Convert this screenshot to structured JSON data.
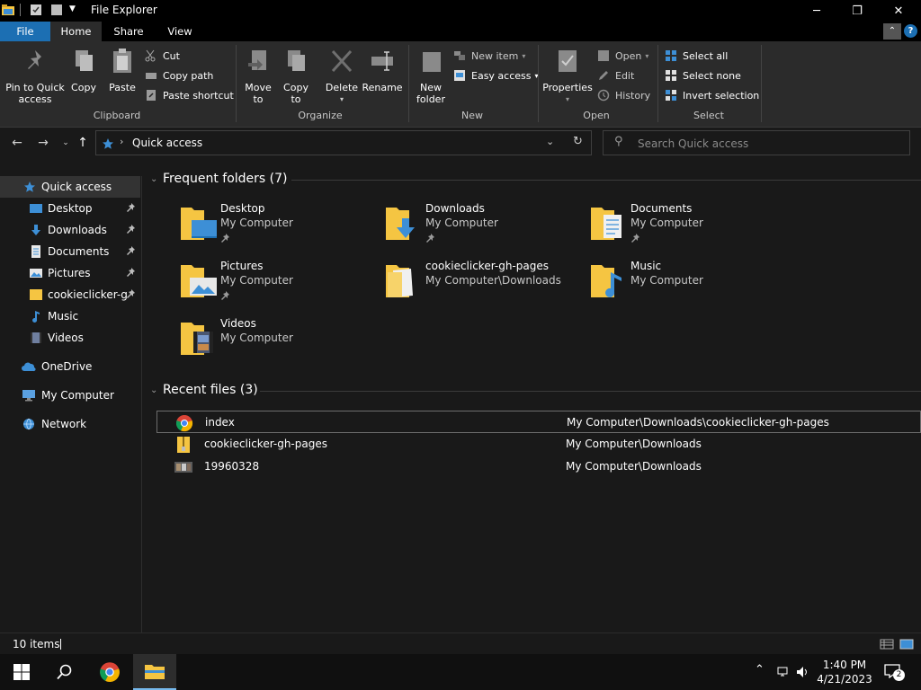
{
  "window": {
    "title": "File Explorer",
    "minimize_glyph": "─",
    "maximize_glyph": "❐",
    "close_glyph": "✕"
  },
  "ribbon_tabs": {
    "file": "File",
    "home": "Home",
    "share": "Share",
    "view": "View",
    "help": "?"
  },
  "ribbon": {
    "clipboard": {
      "pin_line1": "Pin to Quick",
      "pin_line2": "access",
      "copy": "Copy",
      "paste": "Paste",
      "cut": "Cut",
      "copy_path": "Copy path",
      "paste_shortcut": "Paste shortcut",
      "label": "Clipboard"
    },
    "organize": {
      "move_line1": "Move",
      "move_line2": "to",
      "copy_line1": "Copy",
      "copy_line2": "to",
      "delete": "Delete",
      "rename": "Rename",
      "label": "Organize"
    },
    "new": {
      "new_folder_line1": "New",
      "new_folder_line2": "folder",
      "new_item": "New item",
      "easy_access": "Easy access",
      "label": "New"
    },
    "open": {
      "properties": "Properties",
      "open": "Open",
      "edit": "Edit",
      "history": "History",
      "label": "Open"
    },
    "select": {
      "select_all": "Select all",
      "select_none": "Select none",
      "invert_selection": "Invert selection",
      "label": "Select"
    }
  },
  "address": {
    "crumb": "Quick access",
    "search_placeholder": "Search Quick access"
  },
  "nav_pane": {
    "quick_access": "Quick access",
    "desktop": "Desktop",
    "downloads": "Downloads",
    "documents": "Documents",
    "pictures": "Pictures",
    "cookieclicker": "cookieclicker-gh-pages",
    "music": "Music",
    "videos": "Videos",
    "onedrive": "OneDrive",
    "my_computer": "My Computer",
    "network": "Network"
  },
  "frequent": {
    "heading": "Frequent folders (7)",
    "folders": [
      {
        "name": "Desktop",
        "location": "My Computer"
      },
      {
        "name": "Downloads",
        "location": "My Computer"
      },
      {
        "name": "Documents",
        "location": "My Computer"
      },
      {
        "name": "Pictures",
        "location": "My Computer"
      },
      {
        "name": "cookieclicker-gh-pages",
        "location": "My Computer\\Downloads"
      },
      {
        "name": "Music",
        "location": "My Computer"
      },
      {
        "name": "Videos",
        "location": "My Computer"
      }
    ]
  },
  "recent": {
    "heading": "Recent files (3)",
    "files": [
      {
        "name": "index",
        "path": "My Computer\\Downloads\\cookieclicker-gh-pages"
      },
      {
        "name": "cookieclicker-gh-pages",
        "path": "My Computer\\Downloads"
      },
      {
        "name": "19960328",
        "path": "My Computer\\Downloads"
      }
    ]
  },
  "status": {
    "item_count": "10 items"
  },
  "taskbar": {
    "time": "1:40 PM",
    "date": "4/21/2023",
    "notification_count": "2"
  },
  "colors": {
    "accent": "#1c6fb3",
    "folder": "#f5c542",
    "background": "#191919"
  }
}
